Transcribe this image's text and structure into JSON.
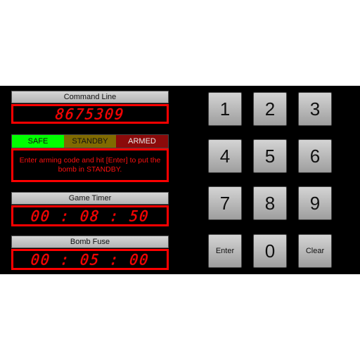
{
  "command_line": {
    "label": "Command Line",
    "value": "8675309"
  },
  "status": {
    "segments": [
      {
        "label": "SAFE",
        "bg": "#00ff00",
        "fg": "#111111"
      },
      {
        "label": "STANDBY",
        "bg": "#806a00",
        "fg": "#111111"
      },
      {
        "label": "ARMED",
        "bg": "#8b0a0a",
        "fg": "#e8e8e8"
      }
    ],
    "message": "Enter arming code and hit [Enter] to put the bomb in STANDBY."
  },
  "game_timer": {
    "label": "Game Timer",
    "value": "00 : 08 : 50"
  },
  "bomb_fuse": {
    "label": "Bomb Fuse",
    "value": "00 : 05 : 00"
  },
  "keypad": {
    "keys": [
      "1",
      "2",
      "3",
      "4",
      "5",
      "6",
      "7",
      "8",
      "9",
      "Enter",
      "0",
      "Clear"
    ]
  },
  "colors": {
    "display_red": "#ff0000",
    "background": "#000000"
  }
}
